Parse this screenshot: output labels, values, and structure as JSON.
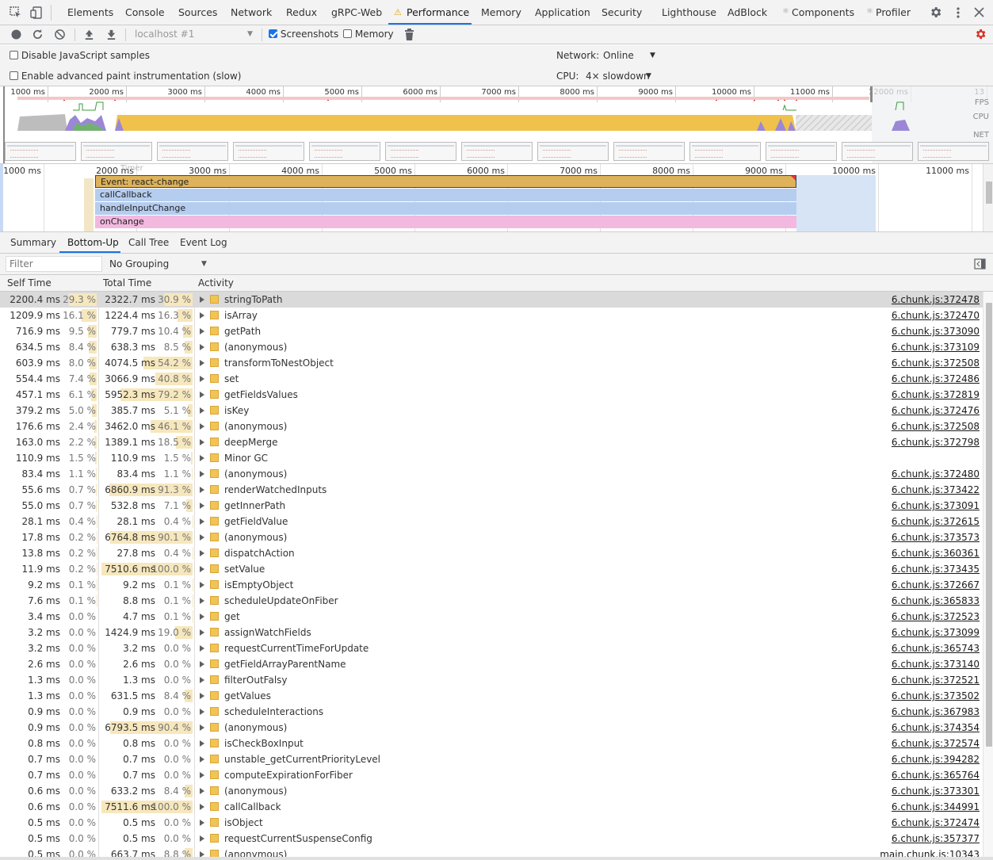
{
  "tabs": [
    "Elements",
    "Console",
    "Sources",
    "Network",
    "Redux",
    "gRPC-Web",
    "Performance",
    "Memory",
    "Application",
    "Security",
    "Lighthouse",
    "AdBlock",
    "Components",
    "Profiler"
  ],
  "toolbar": {
    "target": "localhost #1",
    "screenshots": "Screenshots",
    "memory": "Memory"
  },
  "settings": {
    "disable_js": "Disable JavaScript samples",
    "adv_paint": "Enable advanced paint instrumentation (slow)",
    "network_label": "Network:",
    "network_value": "Online",
    "cpu_label": "CPU:",
    "cpu_value": "4× slowdown"
  },
  "overview": {
    "ticks": [
      "1000 ms",
      "2000 ms",
      "3000 ms",
      "4000 ms",
      "5000 ms",
      "6000 ms",
      "7000 ms",
      "8000 ms",
      "9000 ms",
      "10000 ms",
      "11000 ms",
      "12000 ms",
      "13"
    ],
    "fps": "FPS",
    "cpu": "CPU",
    "net": "NET"
  },
  "flame": {
    "ticks": [
      "1000 ms",
      "2000 ms",
      "3000 ms",
      "4000 ms",
      "5000 ms",
      "6000 ms",
      "7000 ms",
      "8000 ms",
      "9000 ms",
      "10000 ms",
      "11000 ms"
    ],
    "faint": "Timer",
    "rows": [
      "Event: react-change",
      "callCallback",
      "handleInputChange",
      "onChange"
    ]
  },
  "detail_tabs": [
    "Summary",
    "Bottom-Up",
    "Call Tree",
    "Event Log"
  ],
  "filter": {
    "placeholder": "Filter",
    "grouping": "No Grouping"
  },
  "columns": {
    "self": "Self Time",
    "total": "Total Time",
    "activity": "Activity"
  },
  "rows": [
    {
      "self": "2200.4 ms",
      "sp": "29.3 %",
      "total": "2322.7 ms",
      "tp": "30.9 %",
      "name": "stringToPath",
      "url": "6.chunk.js:372478",
      "sv": 29.3,
      "tv": 30.9
    },
    {
      "self": "1209.9 ms",
      "sp": "16.1 %",
      "total": "1224.4 ms",
      "tp": "16.3 %",
      "name": "isArray",
      "url": "6.chunk.js:372470",
      "sv": 16.1,
      "tv": 16.3
    },
    {
      "self": "716.9 ms",
      "sp": "9.5 %",
      "total": "779.7 ms",
      "tp": "10.4 %",
      "name": "getPath",
      "url": "6.chunk.js:373090",
      "sv": 9.5,
      "tv": 10.4
    },
    {
      "self": "634.5 ms",
      "sp": "8.4 %",
      "total": "638.3 ms",
      "tp": "8.5 %",
      "name": "(anonymous)",
      "url": "6.chunk.js:373109",
      "sv": 8.4,
      "tv": 8.5
    },
    {
      "self": "603.9 ms",
      "sp": "8.0 %",
      "total": "4074.5 ms",
      "tp": "54.2 %",
      "name": "transformToNestObject",
      "url": "6.chunk.js:372508",
      "sv": 8.0,
      "tv": 54.2
    },
    {
      "self": "554.4 ms",
      "sp": "7.4 %",
      "total": "3066.9 ms",
      "tp": "40.8 %",
      "name": "set",
      "url": "6.chunk.js:372486",
      "sv": 7.4,
      "tv": 40.8
    },
    {
      "self": "457.1 ms",
      "sp": "6.1 %",
      "total": "5952.3 ms",
      "tp": "79.2 %",
      "name": "getFieldsValues",
      "url": "6.chunk.js:372819",
      "sv": 6.1,
      "tv": 79.2
    },
    {
      "self": "379.2 ms",
      "sp": "5.0 %",
      "total": "385.7 ms",
      "tp": "5.1 %",
      "name": "isKey",
      "url": "6.chunk.js:372476",
      "sv": 5.0,
      "tv": 5.1
    },
    {
      "self": "176.6 ms",
      "sp": "2.4 %",
      "total": "3462.0 ms",
      "tp": "46.1 %",
      "name": "(anonymous)",
      "url": "6.chunk.js:372508",
      "sv": 2.4,
      "tv": 46.1
    },
    {
      "self": "163.0 ms",
      "sp": "2.2 %",
      "total": "1389.1 ms",
      "tp": "18.5 %",
      "name": "deepMerge",
      "url": "6.chunk.js:372798",
      "sv": 2.2,
      "tv": 18.5
    },
    {
      "self": "110.9 ms",
      "sp": "1.5 %",
      "total": "110.9 ms",
      "tp": "1.5 %",
      "name": "Minor GC",
      "url": "",
      "sv": 1.5,
      "tv": 1.5
    },
    {
      "self": "83.4 ms",
      "sp": "1.1 %",
      "total": "83.4 ms",
      "tp": "1.1 %",
      "name": "(anonymous)",
      "url": "6.chunk.js:372480",
      "sv": 1.1,
      "tv": 1.1
    },
    {
      "self": "55.6 ms",
      "sp": "0.7 %",
      "total": "6860.9 ms",
      "tp": "91.3 %",
      "name": "renderWatchedInputs",
      "url": "6.chunk.js:373422",
      "sv": 0.7,
      "tv": 91.3
    },
    {
      "self": "55.0 ms",
      "sp": "0.7 %",
      "total": "532.8 ms",
      "tp": "7.1 %",
      "name": "getInnerPath",
      "url": "6.chunk.js:373091",
      "sv": 0.7,
      "tv": 7.1
    },
    {
      "self": "28.1 ms",
      "sp": "0.4 %",
      "total": "28.1 ms",
      "tp": "0.4 %",
      "name": "getFieldValue",
      "url": "6.chunk.js:372615",
      "sv": 0.4,
      "tv": 0.4
    },
    {
      "self": "17.8 ms",
      "sp": "0.2 %",
      "total": "6764.8 ms",
      "tp": "90.1 %",
      "name": "(anonymous)",
      "url": "6.chunk.js:373573",
      "sv": 0.2,
      "tv": 90.1
    },
    {
      "self": "13.8 ms",
      "sp": "0.2 %",
      "total": "27.8 ms",
      "tp": "0.4 %",
      "name": "dispatchAction",
      "url": "6.chunk.js:360361",
      "sv": 0.2,
      "tv": 0.4
    },
    {
      "self": "11.9 ms",
      "sp": "0.2 %",
      "total": "7510.6 ms",
      "tp": "100.0 %",
      "name": "setValue",
      "url": "6.chunk.js:373435",
      "sv": 0.2,
      "tv": 100.0
    },
    {
      "self": "9.2 ms",
      "sp": "0.1 %",
      "total": "9.2 ms",
      "tp": "0.1 %",
      "name": "isEmptyObject",
      "url": "6.chunk.js:372667",
      "sv": 0.1,
      "tv": 0.1
    },
    {
      "self": "7.6 ms",
      "sp": "0.1 %",
      "total": "8.8 ms",
      "tp": "0.1 %",
      "name": "scheduleUpdateOnFiber",
      "url": "6.chunk.js:365833",
      "sv": 0.1,
      "tv": 0.1
    },
    {
      "self": "3.4 ms",
      "sp": "0.0 %",
      "total": "4.7 ms",
      "tp": "0.1 %",
      "name": "get",
      "url": "6.chunk.js:372523",
      "sv": 0.0,
      "tv": 0.1
    },
    {
      "self": "3.2 ms",
      "sp": "0.0 %",
      "total": "1424.9 ms",
      "tp": "19.0 %",
      "name": "assignWatchFields",
      "url": "6.chunk.js:373099",
      "sv": 0.0,
      "tv": 19.0
    },
    {
      "self": "3.2 ms",
      "sp": "0.0 %",
      "total": "3.2 ms",
      "tp": "0.0 %",
      "name": "requestCurrentTimeForUpdate",
      "url": "6.chunk.js:365743",
      "sv": 0.0,
      "tv": 0.0
    },
    {
      "self": "2.6 ms",
      "sp": "0.0 %",
      "total": "2.6 ms",
      "tp": "0.0 %",
      "name": "getFieldArrayParentName",
      "url": "6.chunk.js:373140",
      "sv": 0.0,
      "tv": 0.0
    },
    {
      "self": "1.3 ms",
      "sp": "0.0 %",
      "total": "1.3 ms",
      "tp": "0.0 %",
      "name": "filterOutFalsy",
      "url": "6.chunk.js:372521",
      "sv": 0.0,
      "tv": 0.0
    },
    {
      "self": "1.3 ms",
      "sp": "0.0 %",
      "total": "631.5 ms",
      "tp": "8.4 %",
      "name": "getValues",
      "url": "6.chunk.js:373502",
      "sv": 0.0,
      "tv": 8.4
    },
    {
      "self": "0.9 ms",
      "sp": "0.0 %",
      "total": "0.9 ms",
      "tp": "0.0 %",
      "name": "scheduleInteractions",
      "url": "6.chunk.js:367983",
      "sv": 0.0,
      "tv": 0.0
    },
    {
      "self": "0.9 ms",
      "sp": "0.0 %",
      "total": "6793.5 ms",
      "tp": "90.4 %",
      "name": "(anonymous)",
      "url": "6.chunk.js:374354",
      "sv": 0.0,
      "tv": 90.4
    },
    {
      "self": "0.8 ms",
      "sp": "0.0 %",
      "total": "0.8 ms",
      "tp": "0.0 %",
      "name": "isCheckBoxInput",
      "url": "6.chunk.js:372574",
      "sv": 0.0,
      "tv": 0.0
    },
    {
      "self": "0.7 ms",
      "sp": "0.0 %",
      "total": "0.7 ms",
      "tp": "0.0 %",
      "name": "unstable_getCurrentPriorityLevel",
      "url": "6.chunk.js:394282",
      "sv": 0.0,
      "tv": 0.0
    },
    {
      "self": "0.7 ms",
      "sp": "0.0 %",
      "total": "0.7 ms",
      "tp": "0.0 %",
      "name": "computeExpirationForFiber",
      "url": "6.chunk.js:365764",
      "sv": 0.0,
      "tv": 0.0
    },
    {
      "self": "0.6 ms",
      "sp": "0.0 %",
      "total": "633.2 ms",
      "tp": "8.4 %",
      "name": "(anonymous)",
      "url": "6.chunk.js:373301",
      "sv": 0.0,
      "tv": 8.4
    },
    {
      "self": "0.6 ms",
      "sp": "0.0 %",
      "total": "7511.6 ms",
      "tp": "100.0 %",
      "name": "callCallback",
      "url": "6.chunk.js:344991",
      "sv": 0.0,
      "tv": 100.0
    },
    {
      "self": "0.5 ms",
      "sp": "0.0 %",
      "total": "0.5 ms",
      "tp": "0.0 %",
      "name": "isObject",
      "url": "6.chunk.js:372474",
      "sv": 0.0,
      "tv": 0.0
    },
    {
      "self": "0.5 ms",
      "sp": "0.0 %",
      "total": "0.5 ms",
      "tp": "0.0 %",
      "name": "requestCurrentSuspenseConfig",
      "url": "6.chunk.js:357377",
      "sv": 0.0,
      "tv": 0.0
    },
    {
      "self": "0.5 ms",
      "sp": "0.0 %",
      "total": "663.7 ms",
      "tp": "8.8 %",
      "name": "(anonymous)",
      "url": "main.chunk.js:10343",
      "sv": 0.0,
      "tv": 8.8
    }
  ]
}
